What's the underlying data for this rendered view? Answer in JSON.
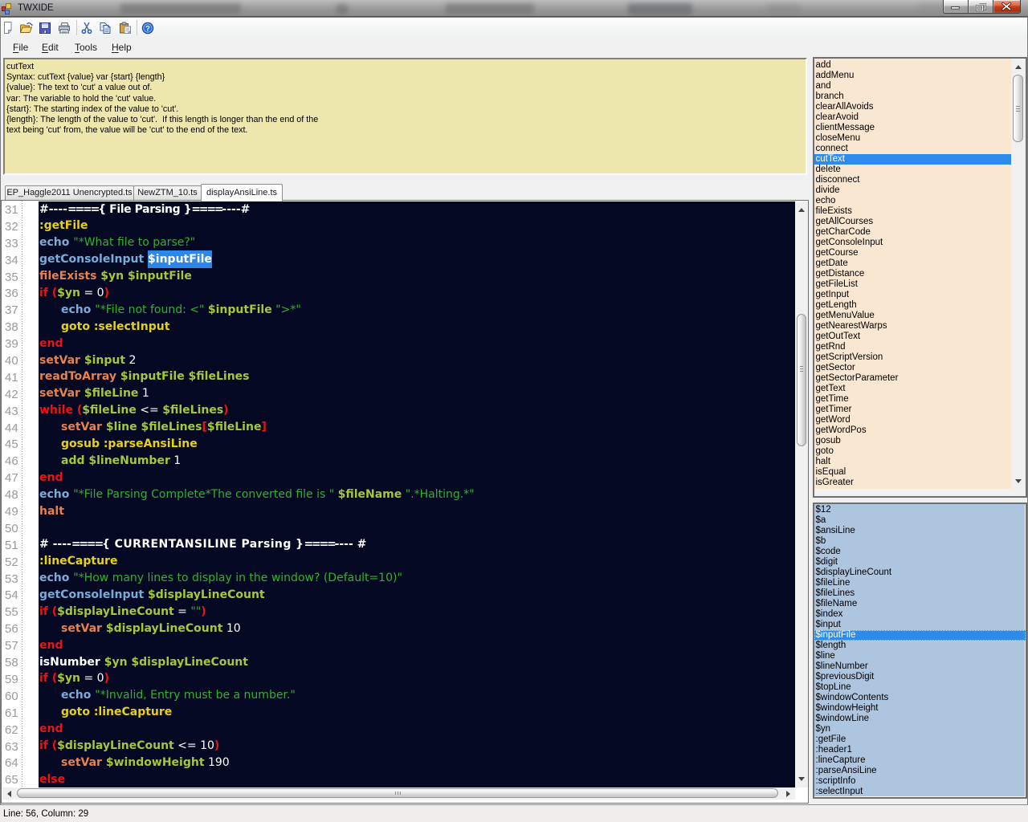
{
  "window": {
    "title": "TWXIDE",
    "controls": [
      "minimize",
      "restore",
      "close"
    ]
  },
  "toolbar": {
    "icons": [
      "new-document",
      "open-folder",
      "save",
      "print",
      "cut",
      "copy",
      "paste",
      "help"
    ]
  },
  "menu": {
    "items": [
      {
        "label": "File",
        "accesskey": "F"
      },
      {
        "label": "Edit",
        "accesskey": "E"
      },
      {
        "label": "Tools",
        "accesskey": "T"
      },
      {
        "label": "Help",
        "accesskey": "H"
      }
    ]
  },
  "help_panel": {
    "lines": [
      "cutText",
      "Syntax: cutText {value} var {start} {length}",
      "{value}: The text to 'cut' a value out of.",
      "var: The variable to hold the 'cut' value.",
      "{start}: The starting index of the value to 'cut'.",
      "{length}: The length of the value to 'cut'.  If this length is longer than the end of the",
      "text being 'cut' from, the value will be 'cut' to the end of the text."
    ]
  },
  "tabs": [
    {
      "label": "EP_Haggle2011 Unencrypted.ts",
      "active": false
    },
    {
      "label": "NewZTM_10.ts",
      "active": false
    },
    {
      "label": "displayAnsiLine.ts",
      "active": true
    }
  ],
  "editor": {
    "colors": {
      "cmt": "#ffffff",
      "cmw": "#ffffff",
      "lbl": "#e7d117",
      "blu": "#79add9",
      "orn": "#e8814a",
      "red": "#ef1212",
      "var": "#a3c939",
      "str": "#2eb32e",
      "wht": "#ffffff",
      "sel_bg": "#2e86e8",
      "sel_fg": "#ffffff",
      "background": "#050823",
      "line_number": "#9a9a9a"
    },
    "selection": {
      "line": 34,
      "text": "$inputFile"
    },
    "lines": [
      {
        "num": 31,
        "indent": 0,
        "tokens": [
          [
            "cmt",
            "#----"
          ],
          [
            "eq",
            "===="
          ],
          [
            "cmtn",
            "{ File Parsing }"
          ],
          [
            "eq",
            "===="
          ],
          [
            "cmt",
            "----#"
          ]
        ]
      },
      {
        "num": 32,
        "indent": 0,
        "tokens": [
          [
            "lbl",
            ":getFile"
          ]
        ]
      },
      {
        "num": 33,
        "indent": 0,
        "tokens": [
          [
            "blu",
            "echo "
          ],
          [
            "str",
            "\"*What file to parse?\""
          ]
        ]
      },
      {
        "num": 34,
        "indent": 0,
        "tokens": [
          [
            "blu",
            "getConsoleInput "
          ],
          [
            "sel",
            "$inputFile"
          ]
        ]
      },
      {
        "num": 35,
        "indent": 0,
        "tokens": [
          [
            "orn",
            "fileExists "
          ],
          [
            "var",
            "$yn $inputFile"
          ]
        ]
      },
      {
        "num": 36,
        "indent": 0,
        "tokens": [
          [
            "red",
            "if ("
          ],
          [
            "var",
            "$yn"
          ],
          [
            "wht",
            " = 0"
          ],
          [
            "red",
            ")"
          ]
        ]
      },
      {
        "num": 37,
        "indent": 1,
        "tokens": [
          [
            "blu",
            "echo "
          ],
          [
            "str",
            "\"*File not found: <\" "
          ],
          [
            "var",
            "$inputFile"
          ],
          [
            "str",
            " \">*\""
          ]
        ]
      },
      {
        "num": 38,
        "indent": 1,
        "tokens": [
          [
            "lbl",
            "goto :selectInput"
          ]
        ]
      },
      {
        "num": 39,
        "indent": 0,
        "tokens": [
          [
            "red",
            "end"
          ]
        ]
      },
      {
        "num": 40,
        "indent": 0,
        "tokens": [
          [
            "orn",
            "setVar "
          ],
          [
            "var",
            "$input"
          ],
          [
            "wht",
            " 2"
          ]
        ]
      },
      {
        "num": 41,
        "indent": 0,
        "tokens": [
          [
            "orn",
            "readToArray "
          ],
          [
            "var",
            "$inputFile $fileLines"
          ]
        ]
      },
      {
        "num": 42,
        "indent": 0,
        "tokens": [
          [
            "orn",
            "setVar "
          ],
          [
            "var",
            "$fileLine"
          ],
          [
            "wht",
            " 1"
          ]
        ]
      },
      {
        "num": 43,
        "indent": 0,
        "tokens": [
          [
            "red",
            "while ("
          ],
          [
            "var",
            "$fileLine"
          ],
          [
            "wht",
            " <= "
          ],
          [
            "var",
            "$fileLines"
          ],
          [
            "red",
            ")"
          ]
        ]
      },
      {
        "num": 44,
        "indent": 1,
        "tokens": [
          [
            "orn",
            "setVar "
          ],
          [
            "var",
            "$line $fileLines"
          ],
          [
            "red",
            "["
          ],
          [
            "var",
            "$fileLine"
          ],
          [
            "red",
            "]"
          ]
        ]
      },
      {
        "num": 45,
        "indent": 1,
        "tokens": [
          [
            "lbl",
            "gosub :parseAnsiLine"
          ]
        ]
      },
      {
        "num": 46,
        "indent": 1,
        "tokens": [
          [
            "var",
            "add $lineNumber"
          ],
          [
            "wht",
            " 1"
          ]
        ]
      },
      {
        "num": 47,
        "indent": 0,
        "tokens": [
          [
            "red",
            "end"
          ]
        ]
      },
      {
        "num": 48,
        "indent": 0,
        "tokens": [
          [
            "blu",
            "echo "
          ],
          [
            "str",
            "\"*File Parsing Complete*The converted file is \" "
          ],
          [
            "var",
            "$fileName"
          ],
          [
            "str",
            " \".*Halting.*\""
          ]
        ]
      },
      {
        "num": 49,
        "indent": 0,
        "tokens": [
          [
            "orn",
            "halt"
          ]
        ]
      },
      {
        "num": 50,
        "indent": 0,
        "tokens": []
      },
      {
        "num": 51,
        "indent": 0,
        "tokens": [
          [
            "cmt",
            "# ----"
          ],
          [
            "eq",
            "===="
          ],
          [
            "cmtw",
            "{ CURRENTANSILINE Parsing }"
          ],
          [
            "eq",
            "===="
          ],
          [
            "cmt",
            "---- #"
          ]
        ]
      },
      {
        "num": 52,
        "indent": 0,
        "tokens": [
          [
            "lbl",
            ":lineCapture"
          ]
        ]
      },
      {
        "num": 53,
        "indent": 0,
        "tokens": [
          [
            "blu",
            "echo "
          ],
          [
            "str",
            "\"*How many lines to display in the window? (Default=10)\""
          ]
        ]
      },
      {
        "num": 54,
        "indent": 0,
        "tokens": [
          [
            "blu",
            "getConsoleInput "
          ],
          [
            "var",
            "$displayLineCount"
          ]
        ]
      },
      {
        "num": 55,
        "indent": 0,
        "tokens": [
          [
            "red",
            "if ("
          ],
          [
            "var",
            "$displayLineCount"
          ],
          [
            "wht",
            " = "
          ],
          [
            "str",
            "\"\""
          ],
          [
            "red",
            ")"
          ]
        ]
      },
      {
        "num": 56,
        "indent": 1,
        "tokens": [
          [
            "orn",
            "setVar "
          ],
          [
            "var",
            "$displayLineCount"
          ],
          [
            "wht",
            " 10"
          ]
        ]
      },
      {
        "num": 57,
        "indent": 0,
        "tokens": [
          [
            "red",
            "end"
          ]
        ]
      },
      {
        "num": 58,
        "indent": 0,
        "tokens": [
          [
            "cmw",
            "isNumber "
          ],
          [
            "var",
            "$yn $displayLineCount"
          ]
        ]
      },
      {
        "num": 59,
        "indent": 0,
        "tokens": [
          [
            "red",
            "if ("
          ],
          [
            "var",
            "$yn"
          ],
          [
            "wht",
            " = 0"
          ],
          [
            "red",
            ")"
          ]
        ]
      },
      {
        "num": 60,
        "indent": 1,
        "tokens": [
          [
            "blu",
            "echo "
          ],
          [
            "str",
            "\"*Invalid, Entry must be a number.\""
          ]
        ]
      },
      {
        "num": 61,
        "indent": 1,
        "tokens": [
          [
            "lbl",
            "goto :lineCapture"
          ]
        ]
      },
      {
        "num": 62,
        "indent": 0,
        "tokens": [
          [
            "red",
            "end"
          ]
        ]
      },
      {
        "num": 63,
        "indent": 0,
        "tokens": [
          [
            "red",
            "if ("
          ],
          [
            "var",
            "$displayLineCount"
          ],
          [
            "wht",
            " <= 10"
          ],
          [
            "red",
            ")"
          ]
        ]
      },
      {
        "num": 64,
        "indent": 1,
        "tokens": [
          [
            "orn",
            "setVar "
          ],
          [
            "var",
            "$windowHeight"
          ],
          [
            "wht",
            " 190"
          ]
        ]
      },
      {
        "num": 65,
        "indent": 0,
        "tokens": [
          [
            "red",
            "else"
          ]
        ]
      }
    ]
  },
  "commands_list": {
    "selected": "cutText",
    "items": [
      "add",
      "addMenu",
      "and",
      "branch",
      "clearAllAvoids",
      "clearAvoid",
      "clientMessage",
      "closeMenu",
      "connect",
      "cutText",
      "delete",
      "disconnect",
      "divide",
      "echo",
      "fileExists",
      "getAllCourses",
      "getCharCode",
      "getConsoleInput",
      "getCourse",
      "getDate",
      "getDistance",
      "getFileList",
      "getInput",
      "getLength",
      "getMenuValue",
      "getNearestWarps",
      "getOutText",
      "getRnd",
      "getScriptVersion",
      "getSector",
      "getSectorParameter",
      "getText",
      "getTime",
      "getTimer",
      "getWord",
      "getWordPos",
      "gosub",
      "goto",
      "halt",
      "isEqual",
      "isGreater"
    ]
  },
  "variables_list": {
    "selected": "$inputFile",
    "items": [
      "$12",
      "$a",
      "$ansiLine",
      "$b",
      "$code",
      "$digit",
      "$displayLineCount",
      "$fileLine",
      "$fileLines",
      "$fileName",
      "$index",
      "$input",
      "$inputFile",
      "$length",
      "$line",
      "$lineNumber",
      "$previousDigit",
      "$topLine",
      "$windowContents",
      "$windowHeight",
      "$windowLine",
      "$yn",
      ":getFile",
      ":header1",
      ":lineCapture",
      ":parseAnsiLine",
      ":scriptInfo",
      ":selectInput"
    ]
  },
  "statusbar": {
    "text": "Line: 56, Column: 29"
  }
}
